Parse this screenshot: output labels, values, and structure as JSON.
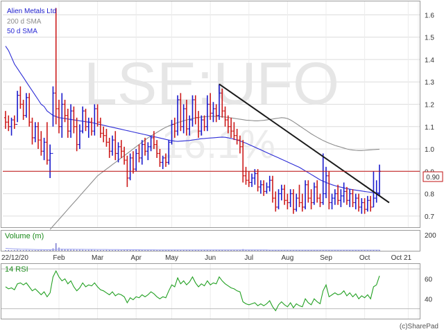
{
  "app": {
    "credit": "(c)SharePad"
  },
  "chart_data": {
    "type": "ohlc",
    "ticker": "Alien Metals Ltd",
    "watermark": "LSE:UFO",
    "watermark_change": "-16.1%",
    "current_price_label": "0.90",
    "colors": {
      "up": "#1a1acc",
      "down": "#cc1a1a",
      "sma200": "#8c8c8c",
      "sma50": "#2b2bd6",
      "trendline": "#1a1a1a",
      "hline": "#c01010",
      "volume": "#7070cc",
      "volume_sma": "#9aa0ee",
      "rsi": "#22a022",
      "grid": "#dcdcdc",
      "ticker_label": "#1a1acc",
      "sma200_label": "#8c8c8c",
      "sma50_label": "#2b2bd6",
      "panel_label": "#1a8a1a"
    },
    "legend": {
      "ticker": "Alien Metals Ltd",
      "sma200": "200 d SMA",
      "sma50": "50 d SMA"
    },
    "price_axis": {
      "min": 0.65,
      "max": 1.66,
      "ticks": [
        "0.7",
        "0.8",
        "0.9",
        "1.0",
        "1.1",
        "1.2",
        "1.3",
        "1.4",
        "1.5",
        "1.6"
      ]
    },
    "x_axis": {
      "labels": [
        "22/12/20",
        "Feb",
        "Mar",
        "Apr",
        "May",
        "Jun",
        "Jul",
        "Aug",
        "Sep",
        "Oct",
        "Oct 21"
      ],
      "months": [
        "Feb",
        "Mar",
        "Apr",
        "May",
        "Jun",
        "Jul",
        "Aug",
        "Sep",
        "Oct",
        "Oct 21"
      ]
    },
    "hline_value": 0.9,
    "ohlc": [
      [
        1.14,
        1.17,
        1.09,
        1.12
      ],
      [
        1.12,
        1.15,
        1.08,
        1.1
      ],
      [
        1.1,
        1.14,
        1.06,
        1.13
      ],
      [
        1.13,
        1.15,
        1.09,
        1.11
      ],
      [
        1.11,
        1.26,
        1.12,
        1.24
      ],
      [
        1.24,
        1.28,
        1.18,
        1.2
      ],
      [
        1.2,
        1.22,
        1.13,
        1.15
      ],
      [
        1.15,
        1.25,
        1.14,
        1.23
      ],
      [
        1.23,
        1.25,
        1.1,
        1.12
      ],
      [
        1.12,
        1.14,
        1.02,
        1.05
      ],
      [
        1.05,
        1.12,
        1.03,
        1.1
      ],
      [
        1.1,
        1.12,
        1.0,
        1.04
      ],
      [
        1.04,
        1.08,
        0.97,
        0.99
      ],
      [
        0.99,
        1.05,
        0.95,
        1.03
      ],
      [
        1.03,
        1.12,
        0.93,
        0.95
      ],
      [
        0.95,
        1.02,
        0.87,
        0.98
      ],
      [
        0.98,
        1.28,
        1.1,
        1.25
      ],
      [
        1.25,
        1.63,
        1.11,
        1.18
      ],
      [
        1.18,
        1.22,
        1.07,
        1.1
      ],
      [
        1.1,
        1.25,
        1.05,
        1.2
      ],
      [
        1.2,
        1.22,
        1.12,
        1.15
      ],
      [
        1.15,
        1.18,
        1.05,
        1.08
      ],
      [
        1.08,
        1.2,
        1.05,
        1.17
      ],
      [
        1.17,
        1.19,
        1.07,
        1.1
      ],
      [
        1.1,
        1.14,
        0.99,
        1.02
      ],
      [
        1.02,
        1.11,
        1.0,
        1.08
      ],
      [
        1.08,
        1.19,
        1.07,
        1.17
      ],
      [
        1.17,
        1.18,
        1.08,
        1.1
      ],
      [
        1.1,
        1.14,
        1.05,
        1.12
      ],
      [
        1.12,
        1.14,
        1.06,
        1.08
      ],
      [
        1.08,
        1.2,
        1.06,
        1.18
      ],
      [
        1.18,
        1.2,
        1.1,
        1.12
      ],
      [
        1.12,
        1.14,
        1.05,
        1.07
      ],
      [
        1.07,
        1.1,
        1.03,
        1.06
      ],
      [
        1.06,
        1.09,
        1.01,
        1.03
      ],
      [
        1.03,
        1.05,
        0.96,
        0.99
      ],
      [
        0.99,
        1.06,
        0.97,
        1.04
      ],
      [
        1.04,
        1.08,
        0.95,
        0.98
      ],
      [
        0.98,
        1.03,
        0.94,
        1.01
      ],
      [
        1.01,
        1.04,
        0.96,
        0.99
      ],
      [
        0.99,
        1.01,
        0.93,
        0.95
      ],
      [
        0.95,
        0.97,
        0.83,
        0.87
      ],
      [
        0.87,
        0.98,
        0.86,
        0.96
      ],
      [
        0.96,
        0.99,
        0.89,
        0.91
      ],
      [
        0.91,
        1.0,
        0.9,
        0.98
      ],
      [
        0.98,
        1.02,
        0.94,
        0.96
      ],
      [
        0.96,
        1.04,
        0.93,
        1.02
      ],
      [
        1.02,
        1.05,
        0.97,
        0.99
      ],
      [
        0.99,
        1.03,
        0.95,
        1.01
      ],
      [
        1.01,
        1.06,
        0.99,
        1.05
      ],
      [
        1.05,
        1.08,
        1.0,
        1.02
      ],
      [
        1.02,
        1.04,
        0.96,
        0.98
      ],
      [
        0.98,
        1.0,
        0.92,
        0.94
      ],
      [
        0.94,
        0.97,
        0.91,
        0.96
      ],
      [
        0.96,
        0.98,
        0.92,
        0.94
      ],
      [
        0.94,
        1.04,
        0.93,
        1.03
      ],
      [
        1.03,
        1.13,
        1.02,
        1.11
      ],
      [
        1.11,
        1.14,
        1.05,
        1.08
      ],
      [
        1.08,
        1.24,
        1.06,
        1.22
      ],
      [
        1.22,
        1.25,
        1.08,
        1.1
      ],
      [
        1.1,
        1.2,
        1.07,
        1.18
      ],
      [
        1.18,
        1.22,
        1.06,
        1.09
      ],
      [
        1.09,
        1.15,
        1.06,
        1.13
      ],
      [
        1.13,
        1.24,
        1.1,
        1.22
      ],
      [
        1.22,
        1.24,
        1.11,
        1.14
      ],
      [
        1.14,
        1.17,
        1.05,
        1.08
      ],
      [
        1.08,
        1.15,
        1.06,
        1.13
      ],
      [
        1.13,
        1.15,
        1.08,
        1.1
      ],
      [
        1.1,
        1.24,
        1.08,
        1.2
      ],
      [
        1.2,
        1.25,
        1.13,
        1.16
      ],
      [
        1.16,
        1.21,
        1.12,
        1.18
      ],
      [
        1.18,
        1.2,
        1.12,
        1.15
      ],
      [
        1.15,
        1.29,
        1.13,
        1.25
      ],
      [
        1.25,
        1.27,
        1.14,
        1.17
      ],
      [
        1.17,
        1.19,
        1.1,
        1.13
      ],
      [
        1.13,
        1.15,
        1.07,
        1.1
      ],
      [
        1.1,
        1.14,
        1.05,
        1.08
      ],
      [
        1.08,
        1.12,
        1.04,
        1.06
      ],
      [
        1.06,
        1.09,
        1.02,
        1.04
      ],
      [
        1.04,
        1.06,
        0.98,
        1.01
      ],
      [
        1.01,
        1.04,
        0.85,
        0.88
      ],
      [
        0.88,
        0.92,
        0.84,
        0.86
      ],
      [
        0.86,
        0.9,
        0.83,
        0.85
      ],
      [
        0.85,
        0.89,
        0.83,
        0.87
      ],
      [
        0.87,
        0.91,
        0.84,
        0.89
      ],
      [
        0.89,
        0.91,
        0.81,
        0.83
      ],
      [
        0.83,
        0.86,
        0.8,
        0.84
      ],
      [
        0.84,
        0.86,
        0.79,
        0.81
      ],
      [
        0.81,
        0.85,
        0.8,
        0.83
      ],
      [
        0.83,
        0.88,
        0.81,
        0.86
      ],
      [
        0.86,
        0.88,
        0.76,
        0.78
      ],
      [
        0.78,
        0.81,
        0.72,
        0.74
      ],
      [
        0.74,
        0.82,
        0.73,
        0.8
      ],
      [
        0.8,
        0.84,
        0.77,
        0.82
      ],
      [
        0.82,
        0.84,
        0.75,
        0.77
      ],
      [
        0.77,
        0.8,
        0.73,
        0.76
      ],
      [
        0.76,
        0.82,
        0.74,
        0.8
      ],
      [
        0.8,
        0.82,
        0.71,
        0.73
      ],
      [
        0.73,
        0.8,
        0.72,
        0.78
      ],
      [
        0.78,
        0.84,
        0.74,
        0.76
      ],
      [
        0.76,
        0.8,
        0.72,
        0.74
      ],
      [
        0.74,
        0.86,
        0.73,
        0.84
      ],
      [
        0.84,
        0.86,
        0.76,
        0.78
      ],
      [
        0.78,
        0.82,
        0.73,
        0.76
      ],
      [
        0.76,
        0.85,
        0.75,
        0.83
      ],
      [
        0.83,
        0.86,
        0.76,
        0.78
      ],
      [
        0.78,
        0.8,
        0.74,
        0.76
      ],
      [
        0.76,
        0.98,
        0.75,
        0.8
      ],
      [
        0.8,
        0.92,
        0.78,
        0.88
      ],
      [
        0.88,
        0.9,
        0.73,
        0.76
      ],
      [
        0.76,
        0.8,
        0.73,
        0.78
      ],
      [
        0.78,
        0.82,
        0.75,
        0.8
      ],
      [
        0.8,
        0.84,
        0.75,
        0.77
      ],
      [
        0.77,
        0.82,
        0.74,
        0.79
      ],
      [
        0.79,
        0.85,
        0.76,
        0.81
      ],
      [
        0.81,
        0.83,
        0.75,
        0.77
      ],
      [
        0.77,
        0.82,
        0.74,
        0.8
      ],
      [
        0.8,
        0.82,
        0.74,
        0.76
      ],
      [
        0.76,
        0.8,
        0.73,
        0.78
      ],
      [
        0.78,
        0.8,
        0.72,
        0.74
      ],
      [
        0.74,
        0.78,
        0.71,
        0.76
      ],
      [
        0.76,
        0.78,
        0.71,
        0.73
      ],
      [
        0.73,
        0.79,
        0.72,
        0.77
      ],
      [
        0.77,
        0.79,
        0.72,
        0.74
      ],
      [
        0.74,
        0.9,
        0.74,
        0.78
      ],
      [
        0.78,
        0.86,
        0.76,
        0.8
      ],
      [
        0.8,
        0.93,
        0.79,
        0.9
      ]
    ],
    "sma50": [
      1.46,
      1.44,
      1.41,
      1.38,
      1.36,
      1.34,
      1.32,
      1.3,
      1.28,
      1.26,
      1.24,
      1.22,
      1.2,
      1.19,
      1.17,
      1.16,
      1.15,
      1.145,
      1.14,
      1.138,
      1.136,
      1.134,
      1.132,
      1.13,
      1.128,
      1.126,
      1.124,
      1.122,
      1.12,
      1.118,
      1.115,
      1.112,
      1.109,
      1.106,
      1.103,
      1.1,
      1.097,
      1.094,
      1.091,
      1.088,
      1.085,
      1.082,
      1.079,
      1.076,
      1.073,
      1.07,
      1.067,
      1.064,
      1.061,
      1.058,
      1.055,
      1.052,
      1.049,
      1.046,
      1.043,
      1.04,
      1.037,
      1.035,
      1.034,
      1.035,
      1.036,
      1.037,
      1.038,
      1.04,
      1.042,
      1.044,
      1.046,
      1.047,
      1.048,
      1.049,
      1.05,
      1.051,
      1.052,
      1.053,
      1.052,
      1.05,
      1.047,
      1.044,
      1.04,
      1.036,
      1.031,
      1.026,
      1.02,
      1.014,
      1.008,
      1.002,
      0.996,
      0.99,
      0.984,
      0.978,
      0.972,
      0.966,
      0.96,
      0.954,
      0.948,
      0.942,
      0.936,
      0.93,
      0.924,
      0.918,
      0.91,
      0.902,
      0.894,
      0.886,
      0.878,
      0.87,
      0.862,
      0.856,
      0.85,
      0.845,
      0.84,
      0.836,
      0.832,
      0.829,
      0.826,
      0.823,
      0.82,
      0.818,
      0.816,
      0.814,
      0.812,
      0.81,
      0.808,
      0.806,
      0.805,
      0.804,
      0.804
    ],
    "sma200_start_index": 15,
    "sma200": [
      0.64,
      0.655,
      0.67,
      0.685,
      0.7,
      0.715,
      0.73,
      0.745,
      0.76,
      0.775,
      0.79,
      0.805,
      0.82,
      0.835,
      0.85,
      0.865,
      0.88,
      0.89,
      0.9,
      0.91,
      0.92,
      0.93,
      0.94,
      0.95,
      0.96,
      0.97,
      0.98,
      0.99,
      1.0,
      1.01,
      1.02,
      1.03,
      1.04,
      1.05,
      1.058,
      1.066,
      1.074,
      1.082,
      1.09,
      1.097,
      1.103,
      1.108,
      1.113,
      1.118,
      1.122,
      1.126,
      1.13,
      1.133,
      1.136,
      1.139,
      1.141,
      1.143,
      1.144,
      1.145,
      1.146,
      1.146,
      1.146,
      1.145,
      1.144,
      1.143,
      1.141,
      1.139,
      1.137,
      1.135,
      1.133,
      1.131,
      1.129,
      1.128,
      1.127,
      1.126,
      1.126,
      1.127,
      1.128,
      1.13,
      1.132,
      1.134,
      1.136,
      1.138,
      1.14,
      1.139,
      1.136,
      1.13,
      1.122,
      1.113,
      1.104,
      1.095,
      1.086,
      1.077,
      1.068,
      1.06,
      1.052,
      1.045,
      1.038,
      1.032,
      1.026,
      1.021,
      1.016,
      1.012,
      1.008,
      1.004,
      1.0,
      0.997,
      0.995,
      0.994,
      0.993,
      0.993,
      0.994,
      0.995,
      0.996,
      0.997,
      0.998,
      0.999
    ],
    "trendline": {
      "x1_index": 72,
      "y1": 1.29,
      "x2_index": 126,
      "y2": 0.76
    },
    "volume": {
      "label": "Volume (m)",
      "axis": {
        "min": 0,
        "max": 250,
        "ticks": [
          "200"
        ]
      },
      "values": [
        8,
        10,
        7,
        9,
        12,
        9,
        8,
        10,
        9,
        7,
        8,
        9,
        10,
        8,
        7,
        9,
        30,
        95,
        40,
        25,
        20,
        18,
        15,
        14,
        12,
        13,
        12,
        10,
        11,
        12,
        10,
        9,
        9,
        8,
        10,
        9,
        8,
        9,
        9,
        8,
        10,
        14,
        9,
        8,
        9,
        10,
        9,
        8,
        9,
        8,
        9,
        10,
        9,
        8,
        8,
        9,
        10,
        9,
        12,
        10,
        9,
        10,
        11,
        9,
        10,
        9,
        8,
        9,
        10,
        9,
        8,
        9,
        12,
        9,
        8,
        8,
        9,
        10,
        9,
        9,
        20,
        12,
        9,
        10,
        9,
        8,
        8,
        7,
        8,
        9,
        10,
        8,
        9,
        8,
        7,
        8,
        9,
        7,
        8,
        7,
        8,
        9,
        7,
        8,
        9,
        8,
        7,
        8,
        10,
        12,
        9,
        8,
        7,
        8,
        8,
        7,
        8,
        7,
        9,
        8,
        7,
        8,
        9,
        10,
        8,
        9,
        12
      ],
      "sma": [
        30,
        28,
        26,
        24,
        22,
        21,
        20,
        19,
        18,
        17,
        16,
        15,
        15,
        14,
        14,
        14,
        15,
        18,
        19,
        19,
        19,
        19,
        19,
        19,
        18,
        18,
        18,
        17,
        17,
        17,
        17,
        16,
        16,
        16,
        16,
        15,
        15,
        15,
        15,
        14,
        14,
        14,
        13,
        13,
        13,
        13,
        12,
        12,
        12,
        12,
        12,
        11,
        11,
        11,
        11,
        11,
        11,
        11,
        11,
        11,
        10,
        10,
        10,
        10,
        10,
        10,
        10,
        10,
        10,
        10,
        10,
        10,
        10,
        10,
        10,
        10,
        10,
        10,
        10,
        10,
        10,
        10,
        10,
        10,
        10,
        10,
        10,
        10,
        10,
        9,
        9,
        9,
        9,
        9,
        9,
        9,
        9,
        9,
        9,
        9,
        9,
        9,
        9,
        9,
        9,
        9,
        9,
        9,
        9,
        9,
        9,
        9,
        9,
        9,
        9,
        9,
        9,
        9,
        9,
        9,
        9,
        9,
        9,
        9,
        9,
        9,
        9
      ]
    },
    "rsi": {
      "label": "14 RSI",
      "axis": {
        "min": 20,
        "max": 75,
        "ticks": [
          "60",
          "40"
        ]
      },
      "reference_levels": [
        70,
        30
      ],
      "values": [
        52,
        50,
        51,
        49,
        55,
        56,
        54,
        56,
        52,
        48,
        50,
        47,
        44,
        47,
        42,
        46,
        62,
        68,
        62,
        58,
        60,
        55,
        58,
        52,
        48,
        51,
        56,
        52,
        54,
        53,
        56,
        52,
        49,
        48,
        46,
        44,
        47,
        43,
        45,
        44,
        42,
        36,
        41,
        39,
        42,
        41,
        44,
        42,
        44,
        47,
        45,
        42,
        40,
        42,
        41,
        48,
        54,
        52,
        61,
        55,
        58,
        54,
        57,
        62,
        56,
        52,
        55,
        53,
        58,
        54,
        56,
        55,
        62,
        58,
        55,
        53,
        51,
        50,
        48,
        47,
        37,
        35,
        34,
        35,
        36,
        33,
        35,
        33,
        35,
        38,
        32,
        28,
        34,
        37,
        34,
        32,
        36,
        31,
        35,
        33,
        32,
        40,
        36,
        34,
        40,
        37,
        35,
        48,
        54,
        42,
        44,
        46,
        44,
        45,
        48,
        43,
        46,
        42,
        45,
        40,
        43,
        41,
        44,
        40,
        52,
        54,
        63
      ]
    },
    "annotations": [
      "(c)SharePad"
    ]
  }
}
